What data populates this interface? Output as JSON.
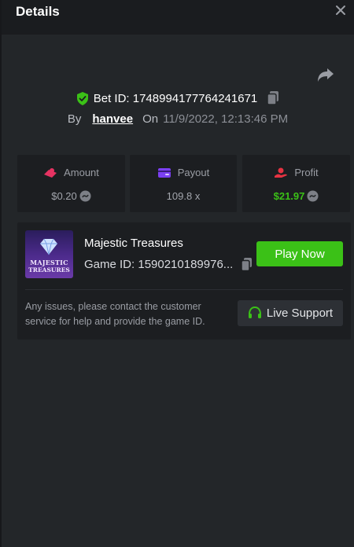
{
  "header": {
    "title": "Details"
  },
  "bet": {
    "id_label": "Bet ID: 1748994177764241671",
    "by_label": "By",
    "user": "hanvee",
    "on_label": "On",
    "timestamp": "11/9/2022, 12:13:46 PM"
  },
  "stats": [
    {
      "label": "Amount",
      "value": "$0.20",
      "icon": "amount-icon",
      "has_coin": true,
      "color": "#e63362"
    },
    {
      "label": "Payout",
      "value": "109.8 x",
      "icon": "payout-icon",
      "has_coin": false,
      "color": "#7b3ff2"
    },
    {
      "label": "Profit",
      "value": "$21.97",
      "icon": "profit-icon",
      "has_coin": true,
      "color": "#e63342"
    }
  ],
  "game": {
    "thumbnail_text_line1": "MAJESTIC",
    "thumbnail_text_line2": "TREASURES",
    "name": "Majestic Treasures",
    "id_label": "Game ID: 1590210189976...",
    "play_label": "Play Now"
  },
  "support": {
    "message": "Any issues, please contact the customer service for help and provide the game ID.",
    "button_label": "Live Support"
  },
  "colors": {
    "accent_green": "#3bc117",
    "panel_bg": "#232629",
    "card_bg": "#1c1e21"
  }
}
